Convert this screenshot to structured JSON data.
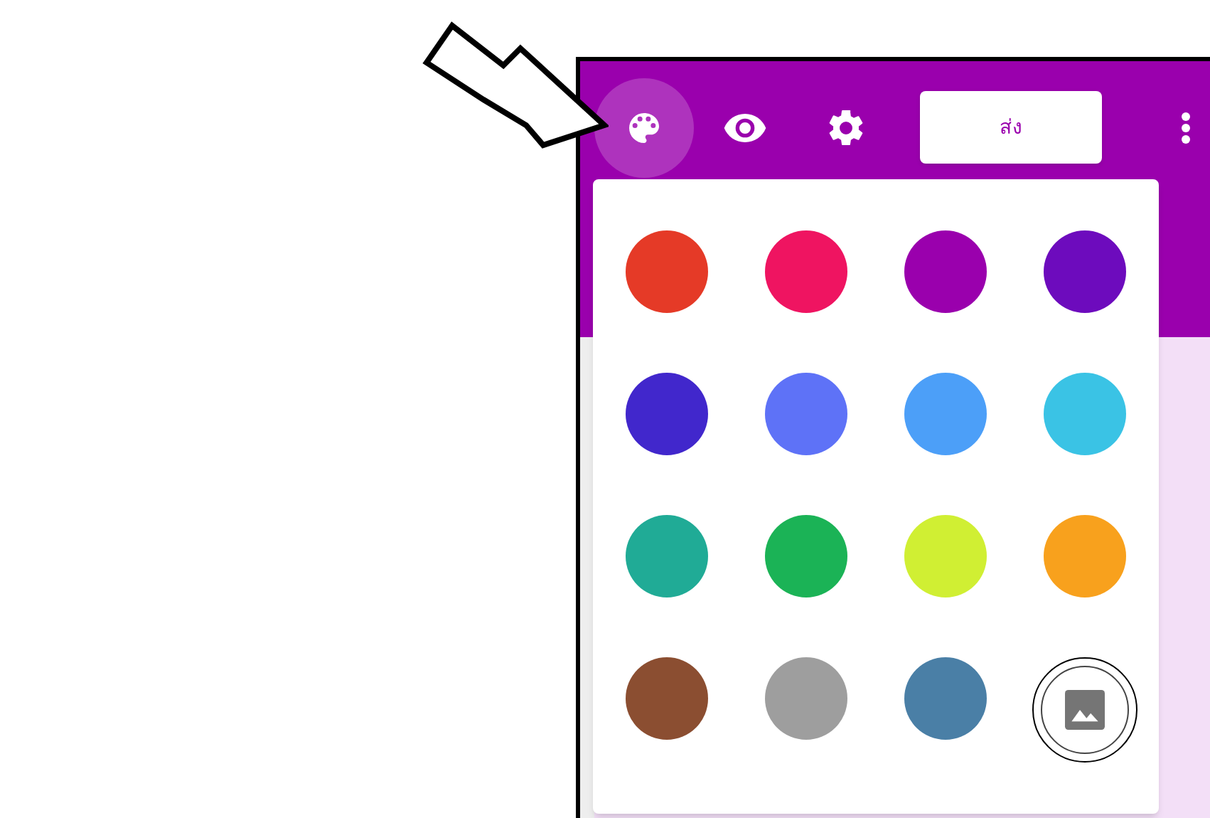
{
  "toolbar": [
    {
      "kind": "palette",
      "selected": true
    },
    {
      "kind": "preview",
      "selected": false
    },
    {
      "kind": "settings",
      "selected": false
    }
  ],
  "send_button": {
    "label": "ส่ง"
  },
  "swatches": [
    {
      "kind": "color",
      "color": "#e53a27"
    },
    {
      "kind": "color",
      "color": "#ef1461"
    },
    {
      "kind": "color",
      "color": "#9a00ad"
    },
    {
      "kind": "color",
      "color": "#6d0bbd"
    },
    {
      "kind": "color",
      "color": "#4127cc"
    },
    {
      "kind": "color",
      "color": "#5e72f7"
    },
    {
      "kind": "color",
      "color": "#4c9ff8"
    },
    {
      "kind": "color",
      "color": "#3ac3e5"
    },
    {
      "kind": "color",
      "color": "#20ab96"
    },
    {
      "kind": "color",
      "color": "#1bb356"
    },
    {
      "kind": "color",
      "color": "#d0ef33"
    },
    {
      "kind": "color",
      "color": "#f8a11d"
    },
    {
      "kind": "color",
      "color": "#8b4e31"
    },
    {
      "kind": "color",
      "color": "#9e9e9e"
    },
    {
      "kind": "color",
      "color": "#4a7fa6"
    },
    {
      "kind": "image"
    }
  ]
}
